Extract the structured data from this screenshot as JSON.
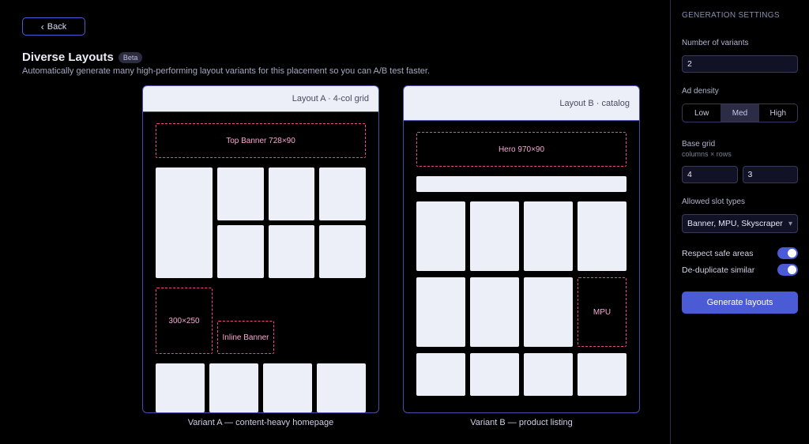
{
  "back": {
    "label": "Back"
  },
  "page": {
    "title": "Diverse Layouts",
    "badge": "Beta",
    "description": "Automatically generate many high-performing layout variants for this placement so you can A/B test faster."
  },
  "cards": {
    "a": {
      "header": "Layout A · 4-col grid",
      "banner1_label": "Top Banner 728×90",
      "side_ad_label": "300×250",
      "banner2_label": "Inline Banner",
      "caption": "Variant A — content-heavy homepage"
    },
    "b": {
      "header": "Layout B · catalog",
      "banner1_label": "Hero 970×90",
      "inline_ad_label": "MPU",
      "caption": "Variant B — product listing"
    }
  },
  "sidebar": {
    "category_label": "Generation settings",
    "variants": {
      "label": "Number of variants",
      "value": "2"
    },
    "density": {
      "label": "Ad density",
      "options": [
        "Low",
        "Med",
        "High"
      ],
      "active": "Med"
    },
    "grid": {
      "label": "Base grid",
      "sub": "columns × rows",
      "cols": "4",
      "rows": "3"
    },
    "slot_types": {
      "label": "Allowed slot types",
      "value": "Banner, MPU, Skyscraper"
    },
    "respect_safe": {
      "label": "Respect safe areas",
      "on": true
    },
    "dedupe": {
      "label": "De-duplicate similar",
      "on": true
    },
    "generate": "Generate layouts"
  }
}
